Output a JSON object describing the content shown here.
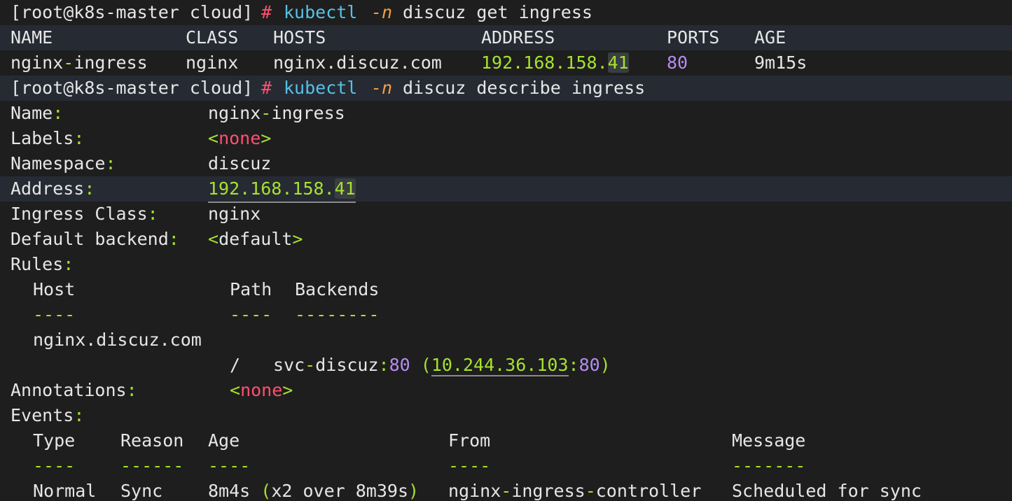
{
  "prompt": {
    "open": "[root@k8s-master cloud]",
    "hash": "#"
  },
  "commands": {
    "get": {
      "bin": "kubectl",
      "flag": "-n",
      "rest": "discuz get ingress"
    },
    "describe": {
      "bin": "kubectl",
      "flag": "-n",
      "rest": "discuz describe ingress"
    }
  },
  "ingress_table": {
    "headers": [
      "NAME",
      "CLASS",
      "HOSTS",
      "ADDRESS",
      "PORTS",
      "AGE"
    ],
    "row": {
      "name_a": "nginx",
      "name_sep": "-",
      "name_b": "ingress",
      "class": "nginx",
      "hosts": "nginx.discuz.com",
      "address_main": "192.168.158.",
      "address_last": "41",
      "ports": "80",
      "age": "9m15s"
    }
  },
  "describe": {
    "name_label": "Name",
    "name_value_a": "nginx",
    "name_value_sep": "-",
    "name_value_b": "ingress",
    "labels_label": "Labels",
    "labels_value": "none",
    "namespace_label": "Namespace",
    "namespace_value": "discuz",
    "address_label": "Address",
    "address_main": "192.168.158.",
    "address_last": "41",
    "ingress_class_label": "Ingress Class",
    "ingress_class_value": "nginx",
    "default_backend_label": "Default backend",
    "default_backend_value": "default",
    "rules_label": "Rules",
    "rules_headers": {
      "host": "Host",
      "path": "Path",
      "backends": "Backends"
    },
    "rules_dashes": {
      "host": "----",
      "path": "----",
      "backends": "--------"
    },
    "rule_host": "nginx.discuz.com",
    "rule_path": "/",
    "rule_service_a": "svc",
    "rule_service_sep": "-",
    "rule_service_b": "discuz",
    "rule_port": "80",
    "rule_endpoint_ip": "10.244.36.103",
    "rule_endpoint_port": "80",
    "annotations_label": "Annotations",
    "annotations_value": "none",
    "events_label": "Events",
    "events_headers": {
      "type": "Type",
      "reason": "Reason",
      "age": "Age",
      "from": "From",
      "message": "Message"
    },
    "events_dashes": {
      "type": "----",
      "reason": "------",
      "age": "----",
      "from": "----",
      "message": "-------"
    },
    "event": {
      "type": "Normal",
      "reason": "Sync",
      "age": "8m4s",
      "age_detail": "x2 over 8m39s",
      "from_a": "nginx",
      "from_sep": "-",
      "from_b": "ingress",
      "from_sep2": "-",
      "from_c": "controller",
      "message": "Scheduled for sync"
    }
  },
  "colors": {
    "background": "#1e1e1e",
    "text": "#e6e6e6",
    "command": "#56c2e6",
    "flag": "#f0a040",
    "accent_red": "#ff4f6f",
    "accent_green": "#a6e22e",
    "number": "#b48cf0"
  }
}
